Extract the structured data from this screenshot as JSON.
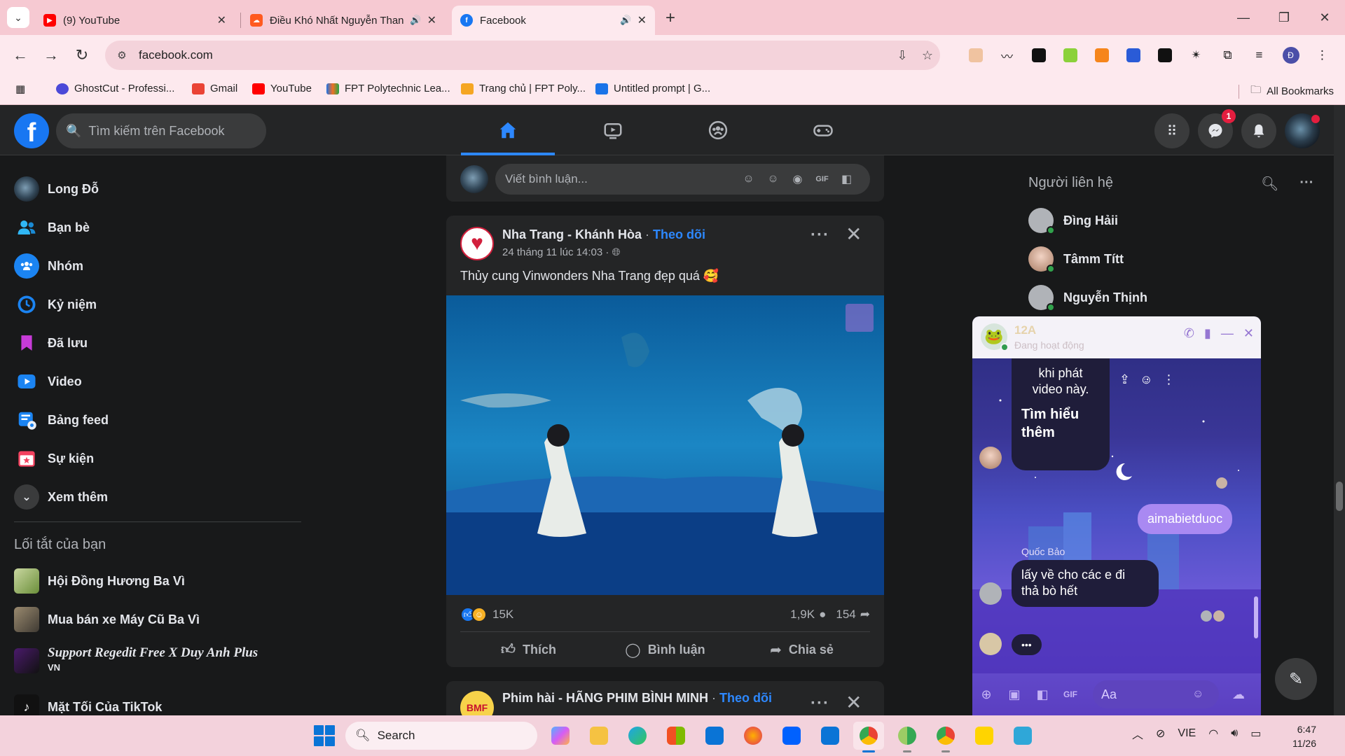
{
  "browser": {
    "tabs": [
      {
        "title": "(9) YouTube",
        "favicon_color": "#ff0000"
      },
      {
        "title": "Điều Khó Nhất Nguyễn Thanh",
        "favicon_color": "#ff5a1f"
      },
      {
        "title": "Facebook",
        "favicon_color": "#1877f2"
      }
    ],
    "url": "facebook.com",
    "profile_initial": "Đ",
    "bookmarks": [
      {
        "label": "GhostCut - Professi...",
        "color": "#4b49d8"
      },
      {
        "label": "Gmail",
        "color": "#ea4335"
      },
      {
        "label": "YouTube",
        "color": "#ff0000"
      },
      {
        "label": "FPT Polytechnic Lea...",
        "color": "#f27022"
      },
      {
        "label": "Trang chủ | FPT Poly...",
        "color": "#f5a623"
      },
      {
        "label": "Untitled prompt | G...",
        "color": "#1a73e8"
      }
    ],
    "all_bookmarks": "All Bookmarks"
  },
  "fb": {
    "search_placeholder": "Tìm kiếm trên Facebook",
    "messenger_badge": "1",
    "sidebar": [
      {
        "label": "Long Đỗ",
        "icon": "profile-avatar"
      },
      {
        "label": "Bạn bè",
        "icon": "friends-icon"
      },
      {
        "label": "Nhóm",
        "icon": "groups-icon"
      },
      {
        "label": "Kỷ niệm",
        "icon": "memories-icon"
      },
      {
        "label": "Đã lưu",
        "icon": "saved-icon"
      },
      {
        "label": "Video",
        "icon": "video-icon"
      },
      {
        "label": "Bảng feed",
        "icon": "feeds-icon"
      },
      {
        "label": "Sự kiện",
        "icon": "events-icon"
      },
      {
        "label": "Xem thêm",
        "icon": "chevron-down-icon"
      }
    ],
    "shortcuts_title": "Lối tắt của bạn",
    "shortcuts": [
      {
        "label": "Hội Đồng Hương Ba Vì"
      },
      {
        "label": "Mua bán xe Máy Cũ Ba Vì"
      },
      {
        "label": "Support Regedit Free X Duy Anh Plus",
        "sub": "VN"
      },
      {
        "label": "Mặt Tối Của TikTok"
      }
    ],
    "comment_placeholder": "Viết bình luận...",
    "post": {
      "page_name": "Nha Trang - Khánh Hòa",
      "follow": "Theo dõi",
      "time": "24 tháng 11 lúc 14:03",
      "text": "Thủy cung Vinwonders Nha Trang đẹp quá 🥰",
      "reactions": "15K",
      "comments": "1,9K",
      "shares": "154",
      "like_label": "Thích",
      "comment_label": "Bình luận",
      "share_label": "Chia sẻ"
    },
    "post2": {
      "page_name": "Phim hài - HÃNG PHIM BÌNH MINH",
      "follow": "Theo dõi",
      "avatar_text": "BMF"
    },
    "contacts_title": "Người liên hệ",
    "contacts": [
      {
        "name": "Đìng Hảii",
        "online": true
      },
      {
        "name": "Tâmm Títt",
        "online": true
      },
      {
        "name": "Nguyễn Thịnh",
        "online": true
      }
    ]
  },
  "chat": {
    "name": "12A",
    "status": "Đang hoạt động",
    "msg_video_1": "khi phát",
    "msg_video_2": "video này.",
    "learn_more_1": "Tìm hiểu",
    "learn_more_2": "thêm",
    "mine": "aimabietduoc",
    "sender": "Quốc Bảo",
    "msg_1": "lấy về cho các e đi",
    "msg_2": "thả bò hết",
    "typing": "•••",
    "input_placeholder": "Aa"
  },
  "taskbar": {
    "search": "Search",
    "lang": "VIE",
    "time": "6:47",
    "date": "11/26"
  }
}
